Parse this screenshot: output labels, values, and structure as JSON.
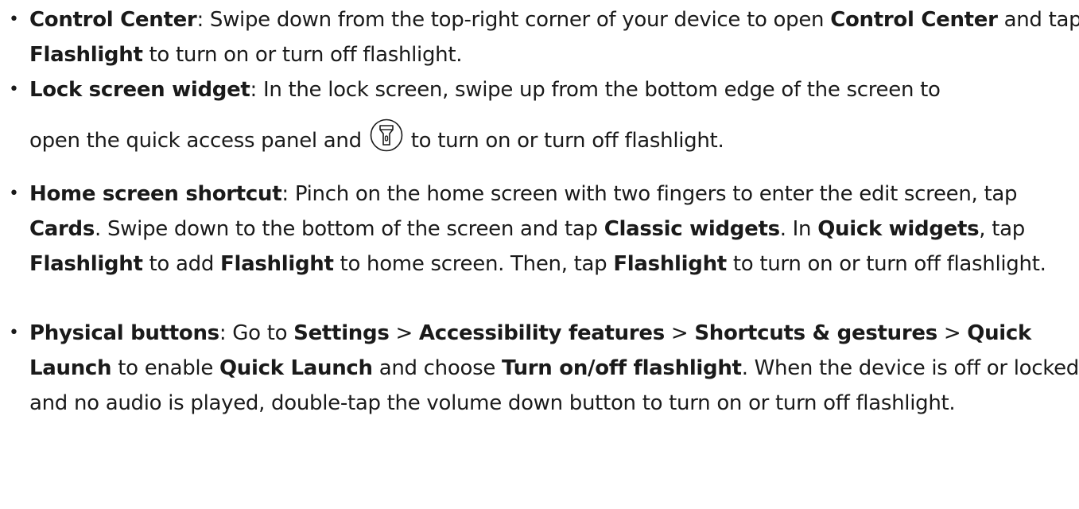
{
  "items": [
    {
      "parts": [
        {
          "t": "Control Center",
          "b": true
        },
        {
          "t": ": Swipe down from the top-right corner of your device to open ",
          "b": false
        },
        {
          "t": "Control Center",
          "b": true
        },
        {
          "t": " and tap ",
          "b": false
        },
        {
          "t": "Flashlight",
          "b": true
        },
        {
          "t": " to turn on or turn off flashlight.",
          "b": false
        }
      ]
    },
    {
      "parts_a": [
        {
          "t": "Lock screen widget",
          "b": true
        },
        {
          "t": ": In the lock screen, swipe up from the bottom edge of the screen to",
          "b": false
        }
      ],
      "parts_b1": "open the quick access panel and ",
      "icon": "flashlight-icon",
      "parts_b2": " to turn on or turn off flashlight."
    },
    {
      "parts": [
        {
          "t": "Home screen shortcut",
          "b": true
        },
        {
          "t": ": Pinch on the home screen with two fingers to enter the edit screen, tap ",
          "b": false
        },
        {
          "t": "Cards",
          "b": true
        },
        {
          "t": ". Swipe down to the bottom of the screen and tap ",
          "b": false
        },
        {
          "t": "Classic widgets",
          "b": true
        },
        {
          "t": ". In ",
          "b": false
        },
        {
          "t": "Quick widgets",
          "b": true
        },
        {
          "t": ", tap ",
          "b": false
        },
        {
          "t": "Flashlight",
          "b": true
        },
        {
          "t": " to add ",
          "b": false
        },
        {
          "t": "Flashlight",
          "b": true
        },
        {
          "t": " to home screen. Then, tap ",
          "b": false
        },
        {
          "t": "Flashlight",
          "b": true
        },
        {
          "t": " to turn on or turn off flashlight.",
          "b": false
        }
      ]
    },
    {
      "parts": [
        {
          "t": "Physical buttons",
          "b": true
        },
        {
          "t": ": Go to ",
          "b": false
        },
        {
          "t": "Settings",
          "b": true
        },
        {
          "t": " > ",
          "b": false
        },
        {
          "t": "Accessibility features",
          "b": true
        },
        {
          "t": " > ",
          "b": false
        },
        {
          "t": "Shortcuts & gestures",
          "b": true
        },
        {
          "t": " > ",
          "b": false
        },
        {
          "t": "Quick Launch",
          "b": true
        },
        {
          "t": " to enable ",
          "b": false
        },
        {
          "t": "Quick Launch",
          "b": true
        },
        {
          "t": " and choose ",
          "b": false
        },
        {
          "t": "Turn on/off flashlight",
          "b": true
        },
        {
          "t": ". When the device is off or locked and no audio is played, double-tap the volume down button to turn on or turn off flashlight.",
          "b": false
        }
      ]
    }
  ],
  "bullet": "•"
}
